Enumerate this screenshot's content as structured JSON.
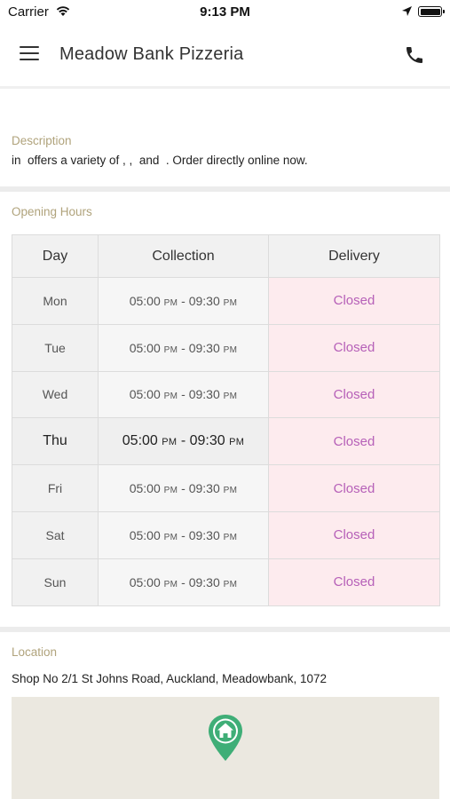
{
  "status_bar": {
    "carrier": "Carrier",
    "time": "9:13 PM"
  },
  "header": {
    "title": "Meadow Bank Pizzeria",
    "menu_icon": "hamburger-menu-icon",
    "call_icon": "phone-icon"
  },
  "description": {
    "label": "Description",
    "text": "in  offers a variety of , ,  and  . Order directly online now."
  },
  "opening_hours": {
    "label": "Opening Hours",
    "columns": [
      "Day",
      "Collection",
      "Delivery"
    ],
    "rows": [
      {
        "day": "Mon",
        "open": "05:00",
        "open_period": "PM",
        "close": "09:30",
        "close_period": "PM",
        "delivery": "Closed"
      },
      {
        "day": "Tue",
        "open": "05:00",
        "open_period": "PM",
        "close": "09:30",
        "close_period": "PM",
        "delivery": "Closed"
      },
      {
        "day": "Wed",
        "open": "05:00",
        "open_period": "PM",
        "close": "09:30",
        "close_period": "PM",
        "delivery": "Closed"
      },
      {
        "day": "Thu",
        "open": "05:00",
        "open_period": "PM",
        "close": "09:30",
        "close_period": "PM",
        "delivery": "Closed"
      },
      {
        "day": "Fri",
        "open": "05:00",
        "open_period": "PM",
        "close": "09:30",
        "close_period": "PM",
        "delivery": "Closed"
      },
      {
        "day": "Sat",
        "open": "05:00",
        "open_period": "PM",
        "close": "09:30",
        "close_period": "PM",
        "delivery": "Closed"
      },
      {
        "day": "Sun",
        "open": "05:00",
        "open_period": "PM",
        "close": "09:30",
        "close_period": "PM",
        "delivery": "Closed"
      }
    ],
    "highlighted_day": "Thu"
  },
  "location": {
    "label": "Location",
    "address": "Shop No 2/1 St Johns Road, Auckland, Meadowbank, 1072",
    "map_pin_icon": "home-map-pin-icon"
  },
  "colors": {
    "section_label": "#b0a37c",
    "closed_text": "#b660b8",
    "closed_bg": "#fdebee",
    "pin_green": "#3fae77"
  }
}
